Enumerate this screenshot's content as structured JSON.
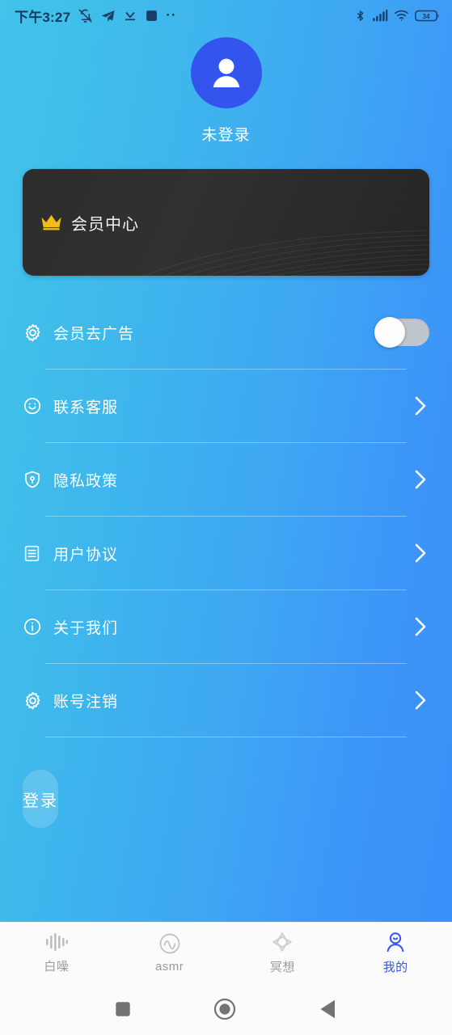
{
  "status_bar": {
    "time": "下午3:27",
    "battery_level": "34",
    "left_icons": [
      "bell-muted-icon",
      "paper-plane-icon",
      "download-icon",
      "square-icon",
      "more-dots-icon"
    ],
    "right_icons": [
      "bluetooth-icon",
      "signal-icon",
      "wifi-icon",
      "battery-icon"
    ]
  },
  "profile": {
    "avatar_icon": "person-avatar-icon",
    "avatar_bg": "#3355ee",
    "nickname": "未登录"
  },
  "vip_banner": {
    "icon": "crown-icon",
    "crown_color": "#f2bd17",
    "label": "会员中心",
    "background": "#2d2d2d"
  },
  "settings": {
    "rows": [
      {
        "icon": "gear-icon",
        "label": "会员去广告",
        "control": "toggle",
        "toggle_on": false
      },
      {
        "icon": "smiley-face-icon",
        "label": "联系客服",
        "control": "chevron"
      },
      {
        "icon": "shield-icon",
        "label": "隐私政策",
        "control": "chevron"
      },
      {
        "icon": "document-lines-icon",
        "label": "用户协议",
        "control": "chevron"
      },
      {
        "icon": "info-circle-icon",
        "label": "关于我们",
        "control": "chevron"
      },
      {
        "icon": "gear-icon",
        "label": "账号注销",
        "control": "chevron"
      }
    ]
  },
  "login_button": {
    "label": "登录"
  },
  "tab_bar": {
    "active_color": "#3355ee",
    "inactive_color": "#9b9b9b",
    "tabs": [
      {
        "icon": "sound-bars-icon",
        "label": "白噪",
        "active": false
      },
      {
        "icon": "wave-circle-icon",
        "label": "asmr",
        "active": false
      },
      {
        "icon": "star-flower-icon",
        "label": "冥想",
        "active": false
      },
      {
        "icon": "person-circle-icon",
        "label": "我的",
        "active": true
      }
    ]
  },
  "nav_bar": {
    "buttons": [
      {
        "icon": "recents-square-icon",
        "label": "recents"
      },
      {
        "icon": "home-circle-icon",
        "label": "home"
      },
      {
        "icon": "back-triangle-icon",
        "label": "back"
      }
    ]
  },
  "theme": {
    "gradient_start": "#41c3ea",
    "gradient_end": "#3a90f9"
  }
}
